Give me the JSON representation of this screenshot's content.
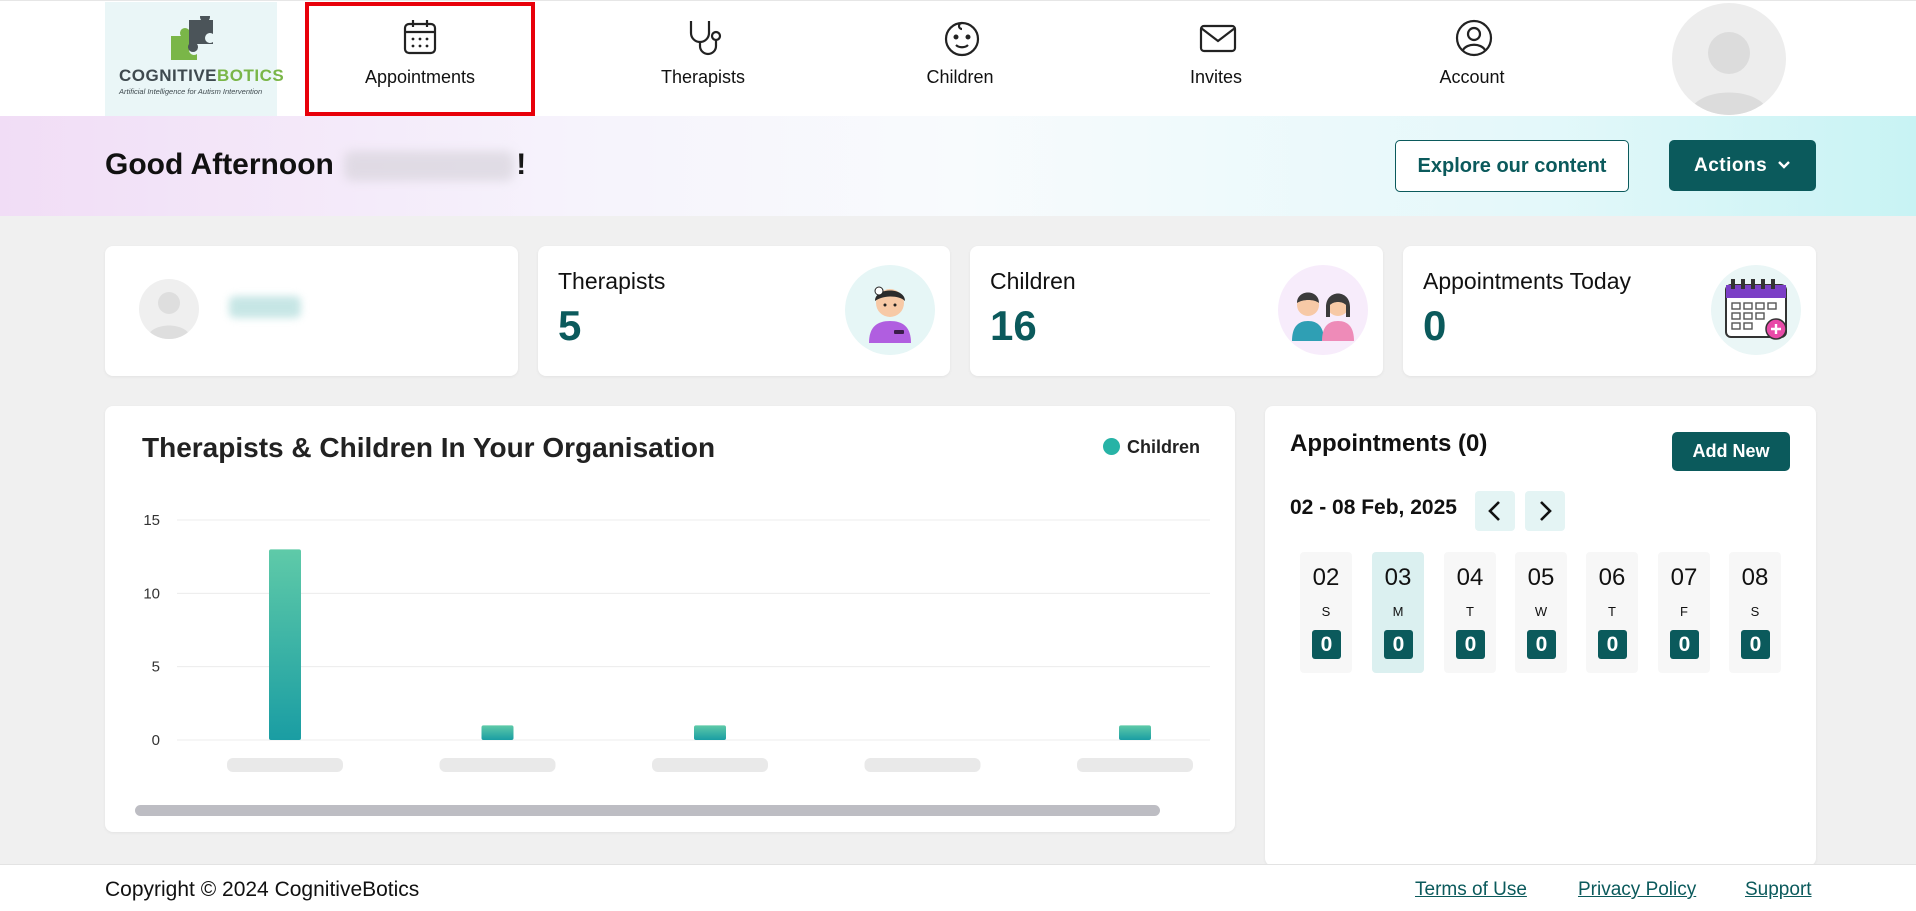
{
  "brand": {
    "name_part1": "COGNITIVE",
    "name_part2": "BOTICS",
    "tagline": "Artificial Intelligence for Autism Intervention"
  },
  "nav": {
    "items": [
      {
        "label": "Appointments",
        "icon": "calendar-icon",
        "active": true
      },
      {
        "label": "Therapists",
        "icon": "stethoscope-icon"
      },
      {
        "label": "Children",
        "icon": "baby-face-icon"
      },
      {
        "label": "Invites",
        "icon": "envelope-icon"
      },
      {
        "label": "Account",
        "icon": "user-circle-icon"
      }
    ]
  },
  "greeting": {
    "prefix": "Good Afternoon",
    "suffix": "!"
  },
  "header_buttons": {
    "explore": "Explore our content",
    "actions": "Actions"
  },
  "stats": [
    {
      "title": "Therapists",
      "value": "5",
      "icon": "therapist-icon"
    },
    {
      "title": "Children",
      "value": "16",
      "icon": "children-icon"
    },
    {
      "title": "Appointments Today",
      "value": "0",
      "icon": "calendar-plus-icon"
    }
  ],
  "chart_data": {
    "type": "bar",
    "title": "Therapists & Children In Your Organisation",
    "legend": "top-right",
    "series": [
      {
        "name": "Children",
        "values": [
          13,
          1,
          1,
          0,
          1
        ]
      }
    ],
    "categories": [
      "",
      "",
      "",
      "",
      ""
    ],
    "ylim": [
      0,
      15
    ],
    "yticks": [
      0,
      5,
      10,
      15
    ],
    "grid": true,
    "colors": {
      "bar_top": "#5fcaa8",
      "bar_bottom": "#1a9da3"
    }
  },
  "appointments": {
    "title": "Appointments (0)",
    "add_label": "Add New",
    "range": "02 - 08 Feb, 2025",
    "days": [
      {
        "date": "02",
        "weekday": "S",
        "count": "0"
      },
      {
        "date": "03",
        "weekday": "M",
        "count": "0",
        "selected": true
      },
      {
        "date": "04",
        "weekday": "T",
        "count": "0"
      },
      {
        "date": "05",
        "weekday": "W",
        "count": "0"
      },
      {
        "date": "06",
        "weekday": "T",
        "count": "0"
      },
      {
        "date": "07",
        "weekday": "F",
        "count": "0"
      },
      {
        "date": "08",
        "weekday": "S",
        "count": "0"
      }
    ]
  },
  "footer": {
    "copyright": "Copyright © 2024 CognitiveBotics",
    "links": [
      "Terms of Use",
      "Privacy Policy",
      "Support"
    ]
  },
  "colors": {
    "primary": "#0b5a5c",
    "active_outline": "#e8000a",
    "accent": "#27b3a6"
  }
}
